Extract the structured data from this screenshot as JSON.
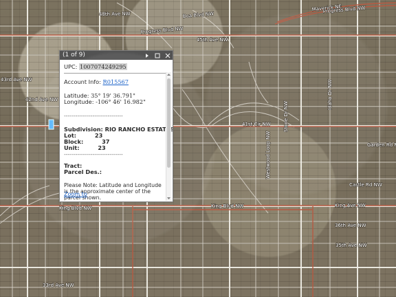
{
  "map": {
    "road_labels": [
      {
        "text": "48th Ave NW"
      },
      {
        "text": "Boa Blvd NW"
      },
      {
        "text": "Progress Blvd NW"
      },
      {
        "text": "Progress Blvd NW"
      },
      {
        "text": "43rd Ave NW"
      },
      {
        "text": "42nd Ave NW"
      },
      {
        "text": "45th Ave NW"
      },
      {
        "text": "41st Cir NW"
      },
      {
        "text": "Garden Rd NW"
      },
      {
        "text": "King Blvd NW"
      },
      {
        "text": "King Blvd NW"
      },
      {
        "text": "King Ave NW"
      },
      {
        "text": "36th Ave NW"
      },
      {
        "text": "35th Ave NW"
      },
      {
        "text": "Castle Rd NW"
      },
      {
        "text": "33rd Ave NW"
      },
      {
        "text": "Maverick NE"
      },
      {
        "text": "Westwood Loop NW"
      },
      {
        "text": "Stone Dr NW"
      },
      {
        "text": "Idaho Dr NW"
      }
    ],
    "highlight_color": "#59b8ff"
  },
  "popup": {
    "title": "(1 of 9)",
    "upc_label": "UPC:",
    "upc_value": "1007074249295",
    "account_label": "Account Info:",
    "account_value": "R015567",
    "latitude_label": "Latitude:",
    "latitude_value": "35° 19' 36.791\"",
    "longitude_label": "Longitude:",
    "longitude_value": "-106° 46' 16.982\"",
    "separator_1": "-------------------------------",
    "subdivision_label": "Subdivision:",
    "subdivision_value": "RIO RANCHO ESTATES",
    "lot_label": "Lot:",
    "lot_value": "23",
    "block_label": "Block:",
    "block_value": "37",
    "unit_label": "Unit:",
    "unit_value": "23",
    "separator_2": "-------------------------------",
    "tract_label": "Tract:",
    "parcel_label": "Parcel Des.:",
    "note": "Please Note: Latitude and Longitude is the approximate center of the parcel shown.",
    "zoom_label": "Zoom to"
  }
}
